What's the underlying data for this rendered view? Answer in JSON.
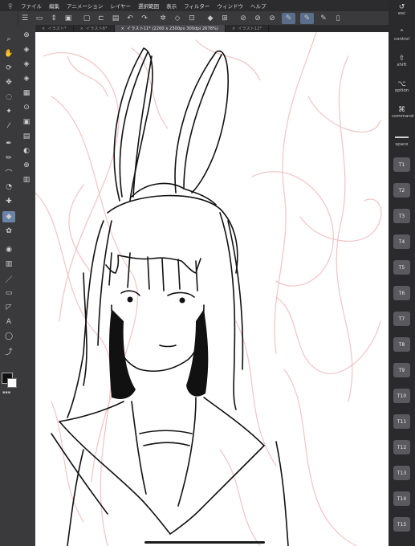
{
  "menu": [
    "ファイル",
    "編集",
    "アニメーション",
    "レイヤー",
    "選択範囲",
    "表示",
    "フィルター",
    "ウィンドウ",
    "ヘルプ"
  ],
  "tabs": [
    {
      "label": "イラスト*",
      "active": false
    },
    {
      "label": "イラスト6*",
      "active": false
    },
    {
      "label": "イラスト11* (2200 x 2300px 300dpi 2678%)",
      "active": true
    },
    {
      "label": "イラスト12*",
      "active": false
    }
  ],
  "modifier_keys": [
    {
      "label": "esc",
      "icon": "↺"
    },
    {
      "label": "control",
      "icon": "⌃"
    },
    {
      "label": "shift",
      "icon": "⇧"
    },
    {
      "label": "option",
      "icon": "⌥"
    },
    {
      "label": "command",
      "icon": "⌘"
    },
    {
      "label": "space",
      "icon": ""
    }
  ],
  "function_keys": [
    "T1",
    "T2",
    "T3",
    "T4",
    "T5",
    "T6",
    "T7",
    "T8",
    "T9",
    "T10",
    "T11",
    "T12",
    "T13",
    "T14",
    "T15"
  ],
  "colors": {
    "main": "#111111",
    "sub": "#ffffff",
    "sketch_guide": "#f2c4c4",
    "ink": "#111111"
  }
}
